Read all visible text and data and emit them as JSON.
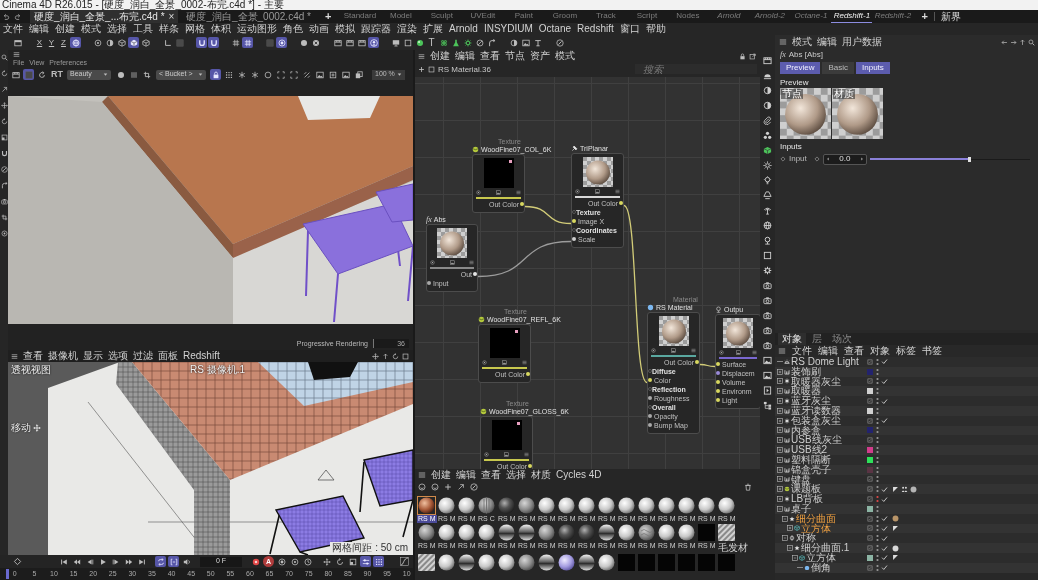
{
  "window": {
    "title": "Cinema 4D R26.015 - [硬度_润白_全景_0002-布完.c4d *] - 主要"
  },
  "documents": [
    {
      "label": "硬度_润白_全景_...布完.c4d *",
      "selected": true,
      "close": "×"
    },
    {
      "label": "硬度_润白_全景_0002.c4d *",
      "selected": false
    }
  ],
  "new_document": "+",
  "layouts": [
    {
      "label": "Standard",
      "custom": false,
      "selected": false
    },
    {
      "label": "Model",
      "custom": false,
      "selected": false
    },
    {
      "label": "Sculpt",
      "custom": false,
      "selected": false
    },
    {
      "label": "UVEdit",
      "custom": false,
      "selected": false
    },
    {
      "label": "Paint",
      "custom": false,
      "selected": false
    },
    {
      "label": "Groom",
      "custom": false,
      "selected": false
    },
    {
      "label": "Track",
      "custom": false,
      "selected": false
    },
    {
      "label": "Script",
      "custom": false,
      "selected": false
    },
    {
      "label": "Nodes",
      "custom": false,
      "selected": false
    },
    {
      "label": "Arnold",
      "custom": true,
      "selected": false
    },
    {
      "label": "Arnold-2",
      "custom": true,
      "selected": false
    },
    {
      "label": "Octane-1",
      "custom": true,
      "selected": false
    },
    {
      "label": "Redshift-1",
      "custom": true,
      "selected": true
    },
    {
      "label": "Redshift-2",
      "custom": true,
      "selected": false
    }
  ],
  "new_layout": "+",
  "layout_more": "新界",
  "menu": [
    "文件",
    "编辑",
    "创建",
    "模式",
    "选择",
    "工具",
    "样条",
    "网格",
    "体积",
    "运动图形",
    "角色",
    "动画",
    "模拟",
    "跟踪器",
    "渲染",
    "扩展",
    "Arnold",
    "INSYDIUM",
    "Octane",
    "Redshift",
    "窗口",
    "帮助"
  ],
  "toolbar": [
    [
      {
        "kind": "frame",
        "on": false
      }
    ],
    [
      {
        "kind": "axis",
        "label": "X",
        "on": false
      },
      {
        "kind": "axis",
        "label": "Y",
        "on": false
      },
      {
        "kind": "axis",
        "label": "Z",
        "on": false
      },
      {
        "kind": "globe",
        "on": true
      }
    ],
    [
      {
        "kind": "dot-circle",
        "on": false
      },
      {
        "kind": "half-circle",
        "on": false
      },
      {
        "kind": "cube",
        "on": false
      },
      {
        "kind": "solid-cube",
        "on": true
      },
      {
        "kind": "cube",
        "on": false
      }
    ],
    [
      {
        "kind": "corner",
        "on": false
      },
      {
        "kind": "dark-square",
        "on": false
      }
    ],
    [
      {
        "kind": "magnet",
        "on": true
      },
      {
        "kind": "magnet",
        "on": true
      }
    ],
    [
      {
        "kind": "grid",
        "on": false
      },
      {
        "kind": "grid",
        "on": true
      }
    ],
    [
      {
        "kind": "dark-square",
        "on": false
      },
      {
        "kind": "target",
        "on": true
      }
    ],
    [
      {
        "kind": "disc",
        "on": false
      },
      {
        "kind": "x-circle",
        "on": false
      }
    ],
    [
      {
        "kind": "film",
        "on": false
      },
      {
        "kind": "film",
        "on": false
      },
      {
        "kind": "film",
        "on": false
      },
      {
        "kind": "person",
        "on": true
      }
    ],
    [
      {
        "kind": "screen",
        "on": false
      },
      {
        "kind": "square",
        "on": false
      },
      {
        "kind": "sphere",
        "on": false
      },
      {
        "kind": "glyph",
        "label": "T",
        "on": false
      },
      {
        "kind": "atom",
        "on": false
      },
      {
        "kind": "flask",
        "on": false
      },
      {
        "kind": "cog",
        "on": false
      },
      {
        "kind": "no-entry",
        "on": false
      },
      {
        "kind": "bend",
        "on": false
      }
    ],
    [
      {
        "kind": "half-circle",
        "on": false
      },
      {
        "kind": "image",
        "on": false
      },
      {
        "kind": "pipe",
        "on": false
      }
    ],
    [
      {
        "kind": "pencil",
        "on": false
      }
    ]
  ],
  "render_view": {
    "menu": [
      "File",
      "View",
      "Preferences"
    ],
    "tools": [
      {
        "kind": "film",
        "on": false
      },
      {
        "kind": "dark-square",
        "on": true
      },
      {
        "kind": "refresh",
        "on": false
      }
    ],
    "mode": "RT",
    "pass": "Beauty",
    "view_tools": [
      {
        "kind": "disc",
        "on": false
      },
      {
        "kind": "bars",
        "on": false
      },
      {
        "kind": "crop",
        "on": false
      }
    ],
    "bucket": "< Bucket >",
    "extra_tools": [
      {
        "kind": "lock",
        "on": true
      },
      {
        "kind": "dots",
        "on": false
      },
      {
        "kind": "snowflake",
        "on": false
      },
      {
        "kind": "snowflake",
        "on": false
      },
      {
        "kind": "circle",
        "on": false
      },
      {
        "kind": "corners",
        "on": false
      },
      {
        "kind": "corners",
        "on": false
      },
      {
        "kind": "slash",
        "on": false
      },
      {
        "kind": "image",
        "on": false
      },
      {
        "kind": "plus-box",
        "on": false
      },
      {
        "kind": "image",
        "on": false
      },
      {
        "kind": "copy",
        "on": false
      }
    ],
    "zoom": "100 %",
    "status": "Progressive Rendering",
    "progress": "36"
  },
  "viewport": {
    "menu": [
      "查看",
      "摄像机",
      "显示",
      "选项",
      "过滤",
      "面板",
      "Redshift"
    ],
    "view_name": "透视视图",
    "camera": "RS 摄像机.1",
    "tool": "移动",
    "grid_spacing": "网格间距 : 50 cm"
  },
  "timeline": {
    "transport": [
      {
        "kind": "skip-back",
        "on": false
      },
      {
        "kind": "step-back",
        "on": false
      },
      {
        "kind": "prev",
        "on": false
      },
      {
        "kind": "play",
        "on": false
      },
      {
        "kind": "next",
        "on": false
      },
      {
        "kind": "step-fwd",
        "on": false
      },
      {
        "kind": "skip-fwd",
        "on": false
      }
    ],
    "modes": [
      {
        "kind": "loop",
        "on": true
      },
      {
        "kind": "range",
        "on": true
      },
      {
        "kind": "speaker",
        "on": false
      }
    ],
    "frame": "0 F",
    "keys": [
      {
        "kind": "record",
        "on": false
      },
      {
        "kind": "auto-key",
        "label": "A",
        "on": false
      },
      {
        "kind": "key",
        "on": false
      },
      {
        "kind": "dot-circle",
        "on": false
      },
      {
        "kind": "clock",
        "on": false
      }
    ],
    "channels": [
      {
        "kind": "move",
        "on": false
      },
      {
        "kind": "rotate",
        "on": false
      },
      {
        "kind": "scale",
        "on": false
      },
      {
        "kind": "sliders",
        "on": true
      },
      {
        "kind": "dots",
        "on": true
      }
    ],
    "ticks": [
      "0",
      "5",
      "10",
      "15",
      "20",
      "25",
      "30",
      "35",
      "40",
      "45",
      "50",
      "55",
      "60",
      "65",
      "70",
      "75",
      "80",
      "85",
      "90",
      "95",
      "10"
    ]
  },
  "node_editor": {
    "menu": [
      "创建",
      "编辑",
      "查看",
      "节点",
      "资产",
      "模式"
    ],
    "path": "RS Material.36",
    "search": {
      "placeholder": "搜索"
    },
    "nodes": [
      {
        "kind": "texture",
        "caption": "Texture",
        "title": "WoodFine07_COL_6K",
        "rows": [
          {
            "kind": "output",
            "label": "Out Color",
            "color": "#d8d860"
          }
        ]
      },
      {
        "kind": "triplanar",
        "title": "TriPlanar",
        "rows": [
          {
            "kind": "output",
            "label": "Out Color",
            "color": "#d8d860"
          },
          {
            "kind": "group",
            "label": "Texture"
          },
          {
            "kind": "input",
            "label": "Image X",
            "color": "#d8d860"
          },
          {
            "kind": "group",
            "label": "Coordinates"
          },
          {
            "kind": "input",
            "label": "Scale",
            "color": "#cfcfcf"
          }
        ]
      },
      {
        "kind": "abs",
        "mark": "fx",
        "title": "Abs",
        "rows": [
          {
            "kind": "output",
            "label": "Out",
            "color": "#e6e6e6"
          },
          {
            "kind": "input",
            "label": "Input",
            "color": "#a8a8a8"
          }
        ]
      },
      {
        "kind": "texture",
        "caption": "Texture",
        "title": "WoodFine07_REFL_6K",
        "rows": [
          {
            "kind": "output",
            "label": "Out Color",
            "color": "#d8d860"
          }
        ]
      },
      {
        "kind": "texture",
        "caption": "Texture",
        "title": "WoodFine07_GLOSS_6K",
        "rows": [
          {
            "kind": "output",
            "label": "Out Color",
            "color": "#d8d860"
          }
        ]
      },
      {
        "kind": "material",
        "caption": "Material",
        "title": "RS Material",
        "rows": [
          {
            "kind": "output",
            "label": "Out Color",
            "color": "#d8d860"
          },
          {
            "kind": "group",
            "label": "Diffuse"
          },
          {
            "kind": "input",
            "label": "Color",
            "color": "#d8d860"
          },
          {
            "kind": "group",
            "label": "Reflection"
          },
          {
            "kind": "input",
            "label": "Roughness",
            "color": "#a8a8a8"
          },
          {
            "kind": "group",
            "label": "Overall"
          },
          {
            "kind": "input",
            "label": "Opacity",
            "color": "#a8a8a8"
          },
          {
            "kind": "input",
            "label": "Bump Map",
            "color": "#a8a8a8"
          }
        ]
      },
      {
        "kind": "output",
        "title": "Outpu",
        "rows": [
          {
            "kind": "input",
            "label": "Surface",
            "color": "#d8d860"
          },
          {
            "kind": "input",
            "label": "Displacem",
            "color": "#9a8ad8"
          },
          {
            "kind": "input",
            "label": "Volume",
            "color": "#d8d860"
          },
          {
            "kind": "input",
            "label": "Environm",
            "color": "#d8d860"
          },
          {
            "kind": "input",
            "label": "Light",
            "color": "#d8d860"
          }
        ]
      }
    ],
    "links": [
      {
        "color": "#d2cc78"
      },
      {
        "color": "#9c9c9c"
      },
      {
        "color": "#d2cc78"
      },
      {
        "color": "#d2cc78"
      }
    ]
  },
  "materials": {
    "menu": [
      "创建",
      "编辑",
      "查看",
      "选择",
      "材质",
      "Cycles 4D"
    ],
    "items": [
      {
        "label": "RS M",
        "kind": "copper",
        "selected": true
      },
      {
        "label": "RS M",
        "kind": "white",
        "selected": false
      },
      {
        "label": "RS M",
        "kind": "white",
        "selected": false
      },
      {
        "label": "RS C",
        "kind": "striped",
        "selected": false
      },
      {
        "label": "RS M",
        "kind": "dark",
        "selected": false
      },
      {
        "label": "RS M",
        "kind": "grey",
        "selected": false
      },
      {
        "label": "RS M",
        "kind": "white",
        "selected": false
      },
      {
        "label": "RS M",
        "kind": "white",
        "selected": false
      },
      {
        "label": "RS M",
        "kind": "white",
        "selected": false
      },
      {
        "label": "RS M",
        "kind": "white",
        "selected": false
      },
      {
        "label": "RS M",
        "kind": "white",
        "selected": false
      },
      {
        "label": "RS M",
        "kind": "white",
        "selected": false
      },
      {
        "label": "RS M",
        "kind": "white",
        "selected": false
      },
      {
        "label": "RS M",
        "kind": "white",
        "selected": false
      },
      {
        "label": "RS M",
        "kind": "white",
        "selected": false
      },
      {
        "label": "RS M",
        "kind": "white",
        "selected": false
      },
      {
        "label": "RS M",
        "kind": "grey",
        "selected": false
      },
      {
        "label": "RS M",
        "kind": "white",
        "selected": false
      },
      {
        "label": "RS M",
        "kind": "white",
        "selected": false
      },
      {
        "label": "RS M",
        "kind": "white",
        "selected": false
      },
      {
        "label": "RS M",
        "kind": "chrome",
        "selected": false
      },
      {
        "label": "RS M",
        "kind": "chrome",
        "selected": false
      },
      {
        "label": "RS M",
        "kind": "grey",
        "selected": false
      },
      {
        "label": "RS M",
        "kind": "dark",
        "selected": false
      },
      {
        "label": "RS M",
        "kind": "dark",
        "selected": false
      },
      {
        "label": "RS M",
        "kind": "chrome",
        "selected": false
      },
      {
        "label": "RS M",
        "kind": "white",
        "selected": false
      },
      {
        "label": "RS M",
        "kind": "pattern",
        "selected": false
      },
      {
        "label": "RS M",
        "kind": "white",
        "selected": false
      },
      {
        "label": "RS M",
        "kind": "white",
        "selected": false
      },
      {
        "label": "RS M",
        "kind": "black",
        "selected": false
      },
      {
        "label": "毛发材",
        "kind": "hatched",
        "selected": false
      },
      {
        "kind": "hatched",
        "selected": false
      },
      {
        "kind": "white",
        "selected": false
      },
      {
        "kind": "chrome",
        "selected": false
      },
      {
        "kind": "white",
        "selected": false
      },
      {
        "kind": "white",
        "selected": false
      },
      {
        "kind": "grey",
        "selected": false
      },
      {
        "kind": "chrome",
        "selected": false
      },
      {
        "kind": "lavender",
        "selected": false
      },
      {
        "kind": "chrome",
        "selected": false
      },
      {
        "kind": "white",
        "selected": false
      },
      {
        "kind": "black",
        "selected": false
      },
      {
        "kind": "black",
        "selected": false
      },
      {
        "kind": "black",
        "selected": false
      },
      {
        "kind": "black",
        "selected": false
      },
      {
        "kind": "black",
        "selected": false
      },
      {
        "kind": "black",
        "selected": false
      }
    ]
  },
  "attributes": {
    "menu": [
      "模式",
      "编辑",
      "用户数据"
    ],
    "mark": "fx",
    "title": "Abs [Abs]",
    "tabs": [
      {
        "label": "Preview",
        "selected": true
      },
      {
        "label": "Basic",
        "selected": false
      },
      {
        "label": "Inputs",
        "selected": true
      }
    ],
    "preview_heading": "Preview",
    "previews": [
      {
        "label": "节点"
      },
      {
        "label": "材质"
      }
    ],
    "inputs_heading": "Inputs",
    "input": {
      "label": "Input",
      "value": "0.0",
      "level": 0.62
    }
  },
  "objects": {
    "tabs": [
      {
        "label": "对象",
        "selected": true
      },
      {
        "label": "层",
        "selected": false
      },
      {
        "label": "场次",
        "selected": false
      }
    ],
    "menu": [
      "文件",
      "编辑",
      "查看",
      "对象",
      "标签",
      "书签"
    ],
    "tree": [
      {
        "name": "RS Dome Light",
        "kind": "light",
        "checked": true,
        "hidden": false,
        "selected": false
      },
      {
        "name": "装饰刷",
        "kind": "null",
        "expanded": false,
        "color": "#23236e",
        "checked": false,
        "hidden": false,
        "selected": false
      },
      {
        "name": "取暖器灰尘",
        "kind": "emitter",
        "expanded": false,
        "checked": true,
        "hidden": false,
        "selected": false
      },
      {
        "name": "取暖器",
        "kind": "null",
        "expanded": false,
        "color": "#d0d0d0",
        "checked": false,
        "hidden": false,
        "selected": false
      },
      {
        "name": "蓝牙灰尘",
        "kind": "emitter",
        "expanded": false,
        "checked": true,
        "hidden": false,
        "selected": false
      },
      {
        "name": "蓝牙读数器",
        "kind": "null",
        "expanded": false,
        "color": "#d0d0d0",
        "checked": false,
        "hidden": false,
        "selected": false
      },
      {
        "name": "包装盒灰尘",
        "kind": "emitter",
        "expanded": false,
        "checked": true,
        "hidden": false,
        "selected": false
      },
      {
        "name": "内参盒",
        "kind": "null",
        "expanded": false,
        "color": "#23236e",
        "checked": false,
        "hidden": false,
        "selected": false
      },
      {
        "name": "USB线灰尘",
        "kind": "null",
        "expanded": false,
        "checked": false,
        "hidden": false,
        "selected": false
      },
      {
        "name": "USB线2",
        "kind": "null",
        "expanded": false,
        "color": "#d23c8c",
        "checked": false,
        "hidden": false,
        "selected": false
      },
      {
        "name": "塑料隔断",
        "kind": "null",
        "expanded": false,
        "color": "#2ee05a",
        "checked": false,
        "hidden": false,
        "selected": false
      },
      {
        "name": "锦盒壳子",
        "kind": "null",
        "expanded": false,
        "color": "#5a3444",
        "checked": false,
        "hidden": false,
        "selected": false
      },
      {
        "name": "键盘",
        "kind": "null",
        "expanded": false,
        "checked": false,
        "hidden": false,
        "selected": false
      },
      {
        "name": "课题板",
        "kind": "ball",
        "expanded": false,
        "checked": true,
        "hidden": false,
        "selected": false,
        "tags": [
          {
            "kind": "phong"
          },
          {
            "kind": "figure"
          },
          {
            "kind": "material",
            "color": "#b4b4b4"
          }
        ]
      },
      {
        "name": "LB背板",
        "kind": "emitter",
        "expanded": false,
        "checked": true,
        "hidden": true,
        "selected": false
      },
      {
        "name": "桌子",
        "kind": "null",
        "expanded": true,
        "color": "#8cb4a4",
        "checked": false,
        "hidden": false,
        "selected": false,
        "children": [
          {
            "name": "细分曲面",
            "kind": "subdivision",
            "expanded": true,
            "checked": true,
            "hidden": false,
            "selected": true,
            "tags": [
              {
                "kind": "material",
                "color": "#b89468"
              }
            ],
            "children": [
              {
                "name": "立方体",
                "kind": "cube",
                "expanded": false,
                "checked": true,
                "hidden": false,
                "selected": true,
                "tags": [
                  {
                    "kind": "phong"
                  }
                ]
              }
            ]
          },
          {
            "name": "对称",
            "kind": "symmetry",
            "expanded": true,
            "checked": true,
            "hidden": false,
            "selected": false,
            "children": [
              {
                "name": "细分曲面.1",
                "kind": "subdivision",
                "expanded": true,
                "checked": true,
                "hidden": false,
                "selected": false,
                "tags": [
                  {
                    "kind": "material",
                    "color": "#d8d8d8"
                  }
                ],
                "children": [
                  {
                    "name": "立方体",
                    "kind": "cube",
                    "expanded": true,
                    "color": "#8cb4a4",
                    "checked": true,
                    "hidden": false,
                    "selected": false,
                    "tags": [
                      {
                        "kind": "phong"
                      }
                    ],
                    "children": [
                      {
                        "name": "倒角",
                        "kind": "bevel",
                        "checked": true,
                        "hidden": false,
                        "selected": false
                      }
                    ]
                  }
                ]
              }
            ]
          }
        ]
      }
    ]
  }
}
